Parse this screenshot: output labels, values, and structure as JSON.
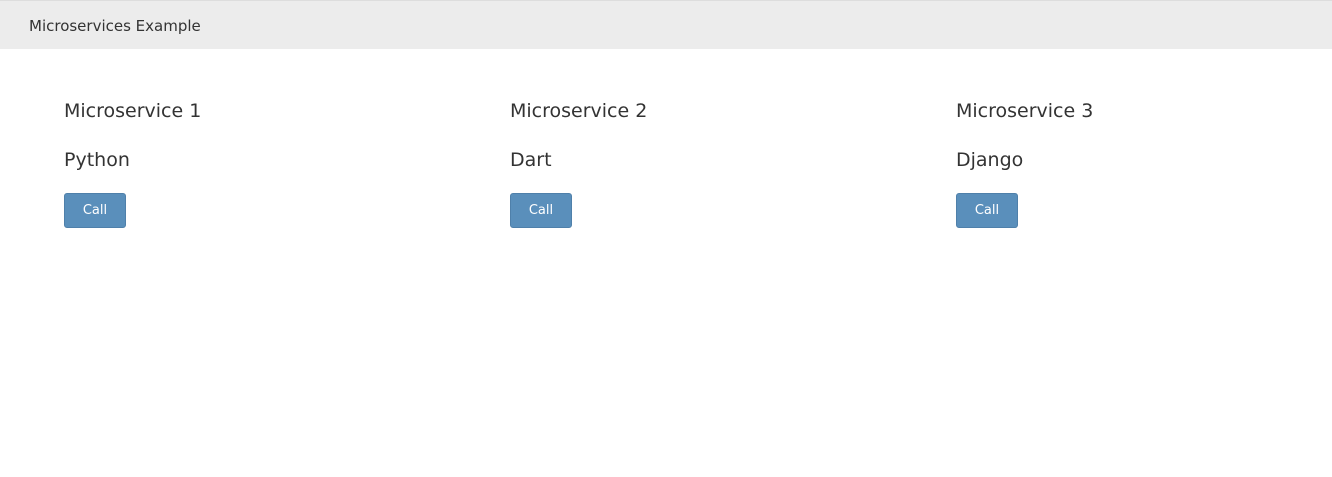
{
  "navbar": {
    "brand": "Microservices Example",
    "background": "#ececec"
  },
  "services": [
    {
      "title": "Microservice 1",
      "tech": "Python",
      "button_label": "Call"
    },
    {
      "title": "Microservice 2",
      "tech": "Dart",
      "button_label": "Call"
    },
    {
      "title": "Microservice 3",
      "tech": "Django",
      "button_label": "Call"
    }
  ],
  "colors": {
    "button": "#5a8fbb",
    "text": "#333333"
  }
}
